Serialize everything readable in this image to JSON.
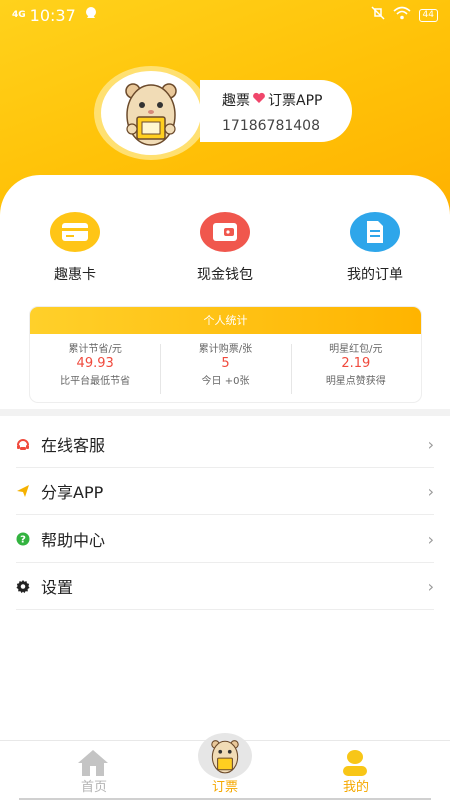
{
  "status_bar": {
    "network": "4G",
    "time": "10:37",
    "battery": "44"
  },
  "profile": {
    "name_prefix": "趣票",
    "name_suffix": "订票APP",
    "phone": "17186781408"
  },
  "quick_actions": [
    {
      "label": "趣惠卡",
      "icon": "card-icon",
      "color": "#ffc516"
    },
    {
      "label": "现金钱包",
      "icon": "wallet-icon",
      "color": "#f0574d"
    },
    {
      "label": "我的订单",
      "icon": "document-icon",
      "color": "#2ea6ea"
    }
  ],
  "stats": {
    "title": "个人统计",
    "items": [
      {
        "label": "累计节省/元",
        "value": "49.93",
        "sub": "比平台最低节省"
      },
      {
        "label": "累计购票/张",
        "value": "5",
        "sub": "今日 +0张"
      },
      {
        "label": "明星红包/元",
        "value": "2.19",
        "sub": "明星点赞获得"
      }
    ]
  },
  "menu": [
    {
      "label": "在线客服",
      "icon": "customer-service-icon",
      "color": "#f04a3d"
    },
    {
      "label": "分享APP",
      "icon": "share-icon",
      "color": "#f5b100"
    },
    {
      "label": "帮助中心",
      "icon": "help-icon",
      "color": "#33b340"
    },
    {
      "label": "设置",
      "icon": "gear-icon",
      "color": "#222222"
    }
  ],
  "tabbar": [
    {
      "label": "首页",
      "icon": "home-icon",
      "color": "#b5b5b5"
    },
    {
      "label": "订票",
      "icon": "mascot-icon",
      "color": "#f5a800"
    },
    {
      "label": "我的",
      "icon": "profile-icon",
      "color": "#f5a800"
    }
  ],
  "colors": {
    "accent": "#ffc208",
    "value_red": "#f04a3d"
  }
}
